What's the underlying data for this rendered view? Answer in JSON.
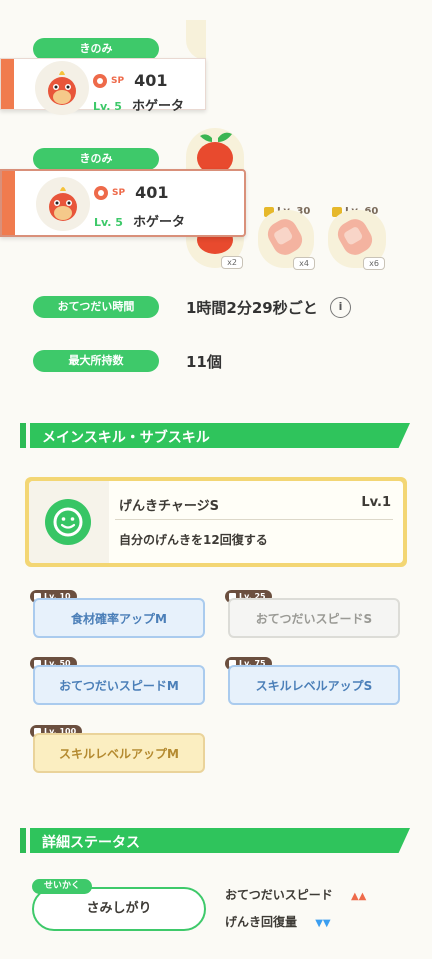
{
  "berry_label": "きのみ",
  "pokemon": {
    "sp_label": "SP",
    "sp_value": "401",
    "level": "Lv. 5",
    "name": "ホゲータ"
  },
  "ingredients": {
    "counts": [
      "x2",
      "x4",
      "x6"
    ],
    "unlock_levels": [
      "Lv. 30",
      "Lv. 60"
    ]
  },
  "stats": {
    "help_time_label": "おてつだい時間",
    "help_time_value": "1時間2分29秒ごと",
    "max_carry_label": "最大所持数",
    "max_carry_value": "11個"
  },
  "sections": {
    "skills": "メインスキル・サブスキル",
    "details": "詳細ステータス"
  },
  "main_skill": {
    "name": "げんきチャージS",
    "level": "Lv.1",
    "description": "自分のげんきを12回復する"
  },
  "sub_skills": [
    {
      "unlock": "Lv. 10",
      "name": "食材確率アップM",
      "style": "blue"
    },
    {
      "unlock": "Lv. 25",
      "name": "おてつだいスピードS",
      "style": "gray"
    },
    {
      "unlock": "Lv. 50",
      "name": "おてつだいスピードM",
      "style": "blue"
    },
    {
      "unlock": "Lv. 75",
      "name": "スキルレベルアップS",
      "style": "blue"
    },
    {
      "unlock": "Lv. 100",
      "name": "スキルレベルアップM",
      "style": "gold"
    }
  ],
  "nature": {
    "tag": "せいかく",
    "value": "さみしがり",
    "up_stat": "おてつだいスピード",
    "up_marks": "▲▲",
    "down_stat": "げんき回復量",
    "down_marks": "▼▼"
  },
  "colors": {
    "accent_green": "#3ec96a",
    "orange": "#f07b4e"
  }
}
